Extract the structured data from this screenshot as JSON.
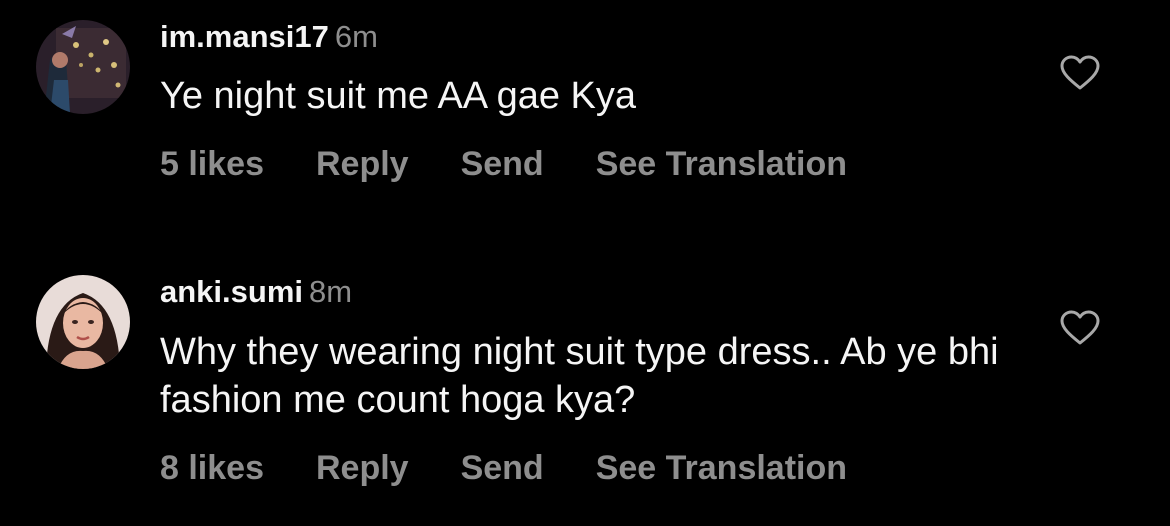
{
  "comments": [
    {
      "username": "im.mansi17",
      "time": "6m",
      "text": "Ye night suit me AA gae Kya",
      "likes": "5 likes",
      "reply_label": "Reply",
      "send_label": "Send",
      "translate_label": "See Translation",
      "like_icon": "heart-outline-icon"
    },
    {
      "username": "anki.sumi",
      "time": "8m",
      "text": "Why they wearing night suit type dress.. Ab ye bhi fashion me count hoga kya?",
      "likes": "8 likes",
      "reply_label": "Reply",
      "send_label": "Send",
      "translate_label": "See Translation",
      "like_icon": "heart-outline-icon"
    }
  ],
  "colors": {
    "background": "#000000",
    "primary_text": "#f5f5f5",
    "secondary_text": "#8e8e8e"
  }
}
